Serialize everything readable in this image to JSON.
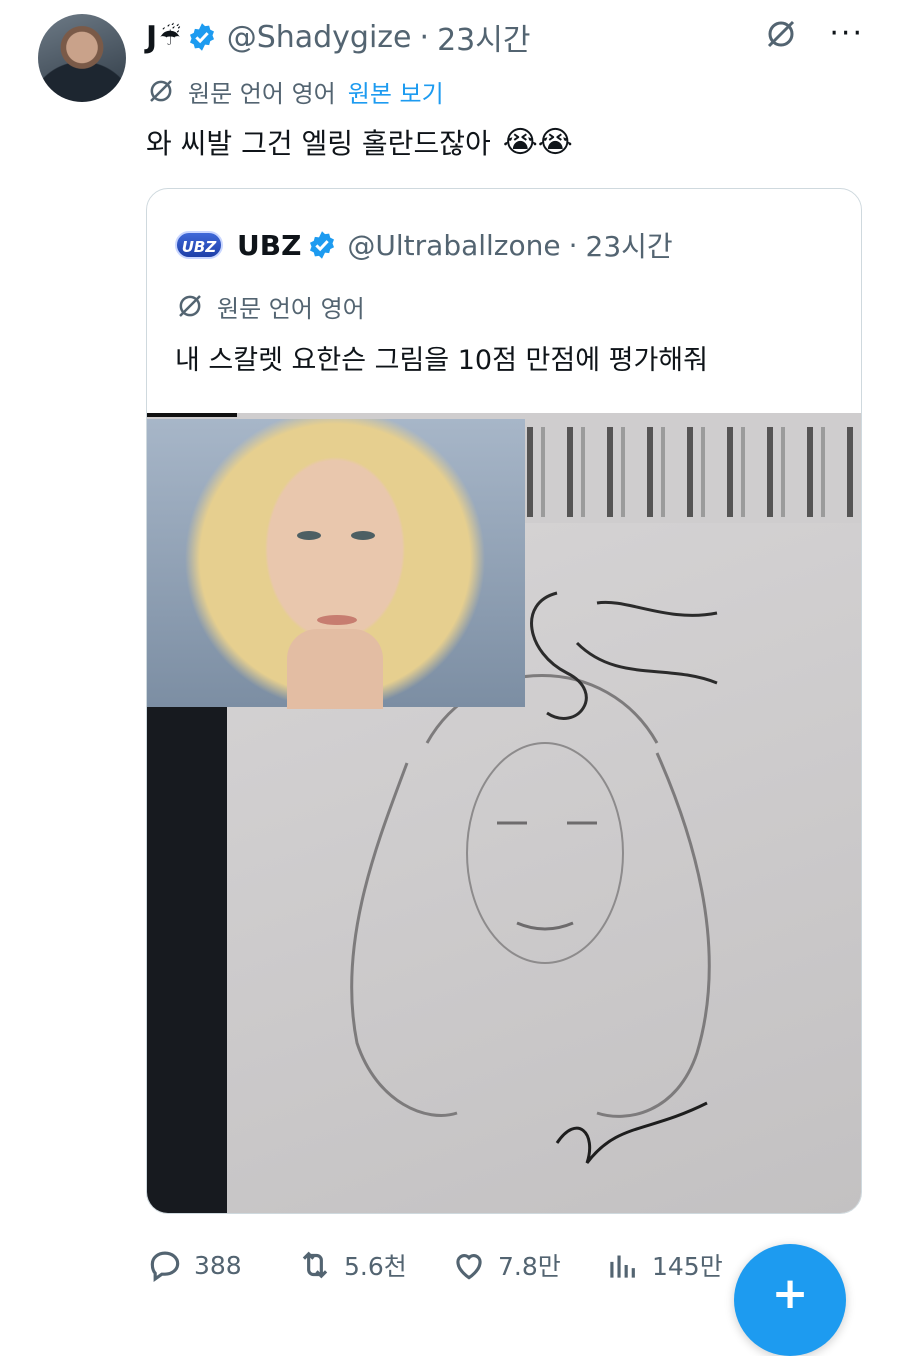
{
  "tweet": {
    "display_name": "J",
    "name_emoji": "☔",
    "handle": "@Shadygize",
    "separator": "·",
    "time": "23시간",
    "translate_label": "원문 언어 영어",
    "show_original": "원본 보기",
    "text": "와 씨발 그건 엘링 홀란드잖아",
    "text_emoji": "😭😭",
    "more": "···"
  },
  "quote": {
    "logo_text": "UBZ",
    "display_name": "UBZ",
    "handle": "@Ultraballzone",
    "separator": "·",
    "time": "23시간",
    "translate_label": "원문 언어 영어",
    "text": "내 스칼렛 요한슨 그림을 10점 만점에 평가해줘"
  },
  "actions": {
    "replies": "388",
    "retweets": "5.6천",
    "likes": "7.8만",
    "views": "145만"
  },
  "compose": {
    "label": "+"
  },
  "colors": {
    "accent": "#1d9bf0",
    "secondary_text": "#536471",
    "border": "#cfd9de"
  }
}
